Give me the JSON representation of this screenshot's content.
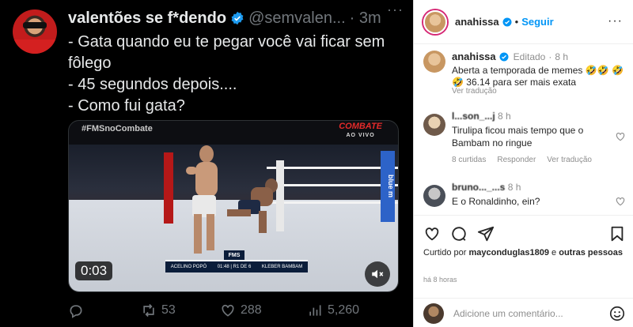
{
  "tweet": {
    "display_name": "valentões se f*dendo",
    "handle": "@semvalen...",
    "time": "· 3m",
    "more": "···",
    "lines": [
      "- Gata quando eu te pegar você vai ficar sem",
      "fôlego",
      "- 45 segundos depois....",
      "- Como fui gata?"
    ],
    "video": {
      "hashtag": "#FMSnoCombate",
      "channel": "COMBATE",
      "channel_sub": "AO VIVO",
      "duration": "0:03",
      "scoreboard": {
        "left_fighter": "ACELINO POPÓ",
        "clock": "01:48 | R1 DE 6",
        "right_fighter": "KLEBER BAMBAM",
        "event": "FMS"
      }
    },
    "actions": {
      "reply_count": "",
      "retweet_count": "53",
      "like_count": "288",
      "view_count": "5,260"
    },
    "colors": {
      "verified": "#1d9bf0",
      "muted": "#71767b"
    }
  },
  "instagram": {
    "header": {
      "username": "anahissa",
      "follow_label": "Seguir",
      "separator": "•",
      "more": "···"
    },
    "caption": {
      "username": "anahissa",
      "edited_label": "Editado",
      "time": "8 h",
      "text": "Aberta a temporada de memes 🤣🤣 🤣🤣 36.14 para ser mais exata",
      "see_translation": "Ver tradução"
    },
    "comments": [
      {
        "username": "l...son_...j",
        "time": "8 h",
        "text": "Tirulipa ficou mais tempo que o Bambam no ringue",
        "likes": "8 curtidas",
        "reply_label": "Responder",
        "translate_label": "Ver tradução"
      },
      {
        "username": "bruno..._...s",
        "time": "8 h",
        "text": "E o Ronaldinho, ein?"
      }
    ],
    "liked_by": {
      "prefix": "Curtido por",
      "user": "mayconduglas1809",
      "suffix": "e",
      "others": "outras pessoas"
    },
    "post_time": "há 8 horas",
    "add_comment_placeholder": "Adicione um comentário...",
    "colors": {
      "link": "#0095f6",
      "muted": "#8e8e8e",
      "text": "#262626"
    }
  }
}
